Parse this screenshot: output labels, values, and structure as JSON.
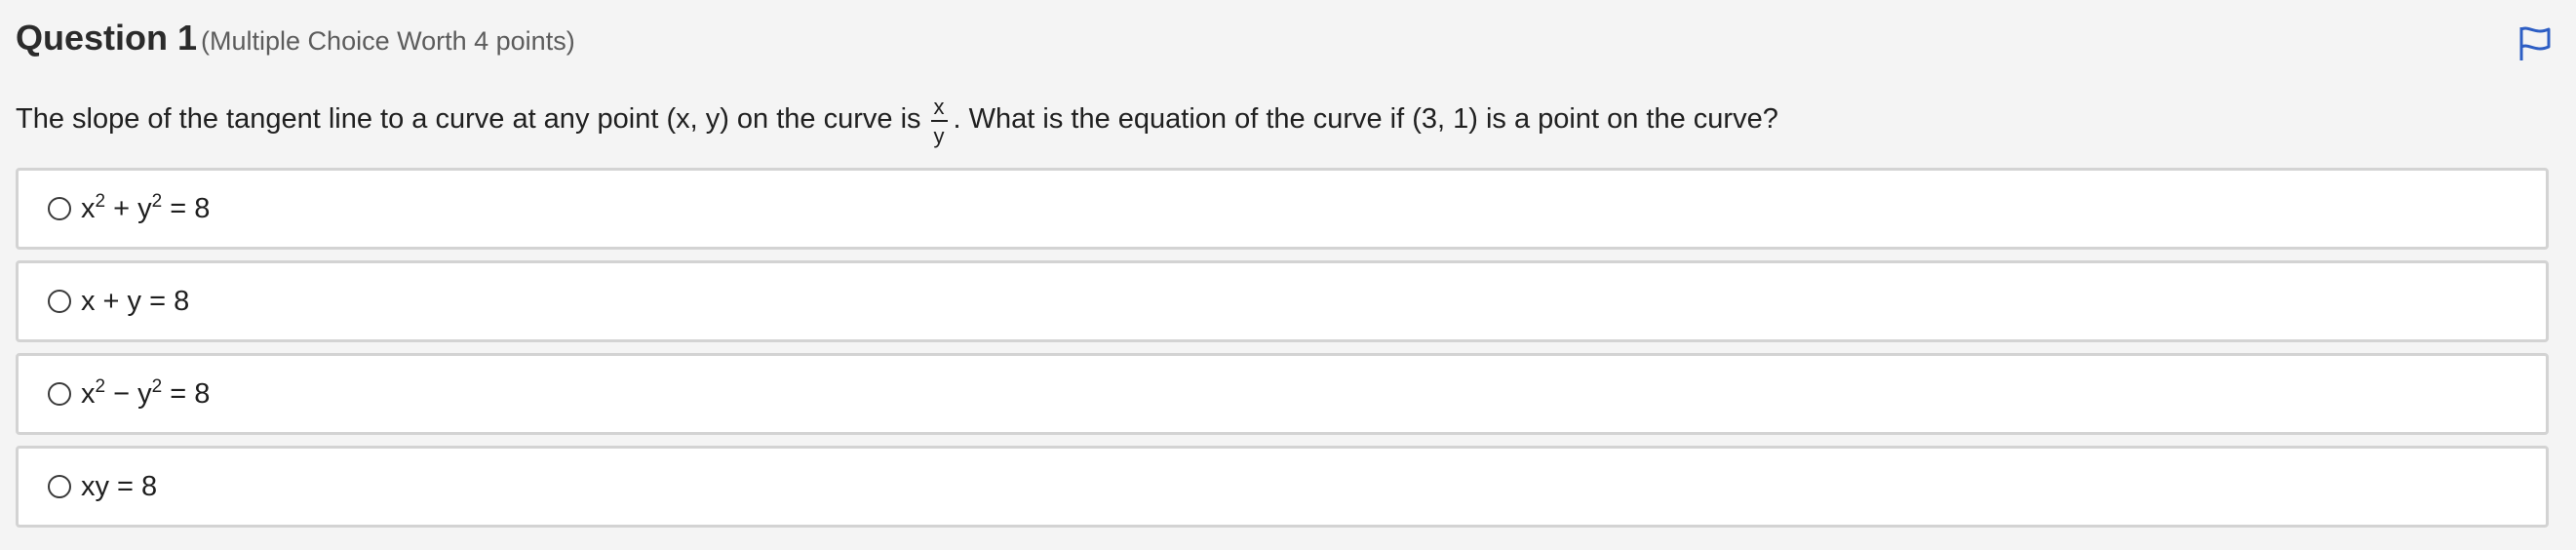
{
  "question": {
    "title": "Question 1",
    "meta": "(Multiple Choice Worth 4 points)",
    "prompt_before": "The slope of the tangent line to a curve at any point (x, y) on the curve is",
    "fraction_numerator": "x",
    "fraction_denominator": "y",
    "prompt_after": ". What is the equation of the curve if (3, 1) is a point on the curve?"
  },
  "flag": {
    "icon": "flag-icon",
    "color": "#2d5ec4"
  },
  "options": [
    {
      "parts": [
        "x",
        "2",
        " + y",
        "2",
        " = 8"
      ]
    },
    {
      "parts": [
        "x + y = 8"
      ]
    },
    {
      "parts": [
        "x",
        "2",
        " − y",
        "2",
        " = 8"
      ]
    },
    {
      "parts": [
        "xy = 8"
      ]
    }
  ],
  "colors": {
    "background": "#f4f4f4",
    "option_border": "#d3d3d3",
    "option_background": "#ffffff"
  }
}
